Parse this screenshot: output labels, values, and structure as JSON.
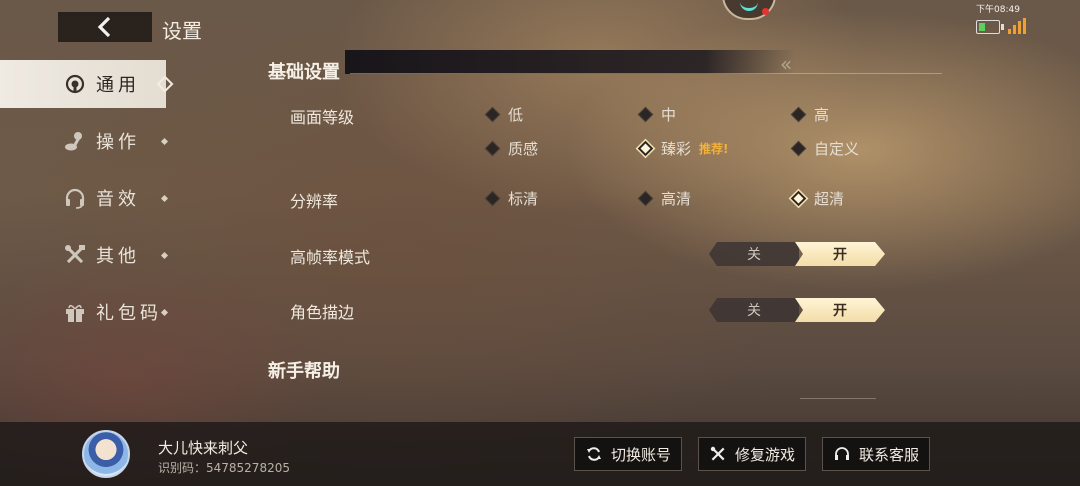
{
  "header": {
    "title": "设置"
  },
  "status_bar": {
    "time": "下午08:49",
    "battery_color": "#5bd15f",
    "signal_color": "#f0a030"
  },
  "sidebar": {
    "items": [
      {
        "label": "通用",
        "icon": "broadcast-icon",
        "active": true
      },
      {
        "label": "操作",
        "icon": "joystick-icon",
        "active": false
      },
      {
        "label": "音效",
        "icon": "headset-icon",
        "active": false
      },
      {
        "label": "其他",
        "icon": "tools-icon",
        "active": false
      },
      {
        "label": "礼包码",
        "icon": "gift-icon",
        "active": false
      }
    ]
  },
  "sections": {
    "basic": {
      "title": "基础设置",
      "quality": {
        "label": "画面等级",
        "options": [
          "低",
          "中",
          "高",
          "质感",
          "臻彩",
          "自定义"
        ],
        "selected": "臻彩",
        "recommend_tag": "推荐!"
      },
      "resolution": {
        "label": "分辨率",
        "options": [
          "标清",
          "高清",
          "超清"
        ],
        "selected": "超清"
      },
      "high_fps": {
        "label": "高帧率模式",
        "off": "关",
        "on": "开",
        "value": "开"
      },
      "outline": {
        "label": "角色描边",
        "off": "关",
        "on": "开",
        "value": "开"
      }
    },
    "help": {
      "title": "新手帮助"
    }
  },
  "footer": {
    "username": "大儿快来刺父",
    "uid_label": "识别码：54785278205",
    "buttons": {
      "switch_account": "切换账号",
      "repair_game": "修复游戏",
      "contact_support": "联系客服"
    }
  },
  "colors": {
    "accent_gold": "#f3dda8",
    "recommend": "#f1b13a",
    "active_tab": "#efeae2"
  }
}
